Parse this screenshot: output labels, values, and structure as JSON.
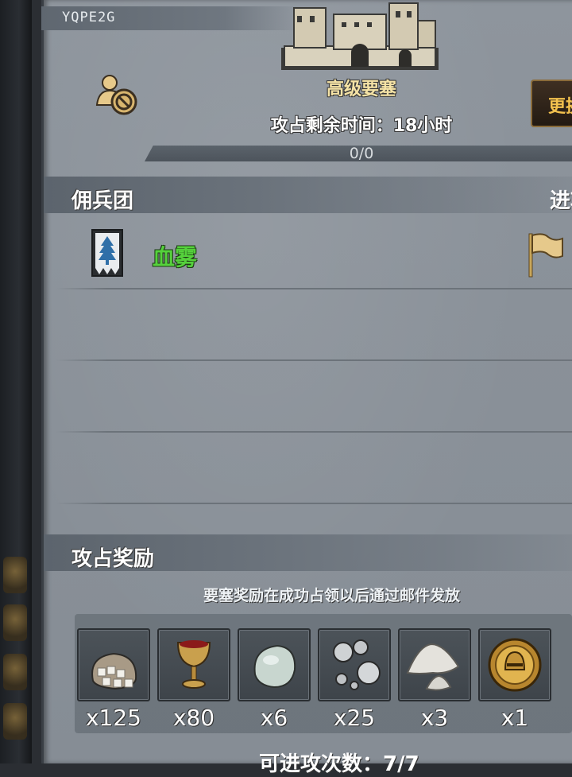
{
  "header": {
    "player_id": "YQPE2G",
    "fortress_name": "高级要塞",
    "time_remaining": "攻占剩余时间：18小时",
    "progress_text": "0/0",
    "progress_fraction": 0,
    "side_button_label": "更换"
  },
  "mercenary_section": {
    "title": "佣兵团",
    "right_label": "进攻",
    "members": [
      {
        "name": "血雾",
        "name_color": "#55d13c"
      }
    ]
  },
  "rewards_section": {
    "title": "攻占奖励",
    "note": "要塞奖励在成功占领以后通过邮件发放",
    "items": [
      {
        "icon": "sugar-sack-icon",
        "quantity": "x125"
      },
      {
        "icon": "goblet-icon",
        "quantity": "x80"
      },
      {
        "icon": "moonstone-icon",
        "quantity": "x6"
      },
      {
        "icon": "silver-orbs-icon",
        "quantity": "x25"
      },
      {
        "icon": "powder-pile-icon",
        "quantity": "x3"
      },
      {
        "icon": "knight-helmet-medal-icon",
        "quantity": "x1"
      }
    ]
  },
  "footer": {
    "attack_count": "可进攻次数：7/7"
  },
  "colors": {
    "panel_bg": "#8a9199",
    "gold_text": "#f5e3a6",
    "accent_gold": "#f2c14e",
    "merc_green": "#55d13c"
  }
}
